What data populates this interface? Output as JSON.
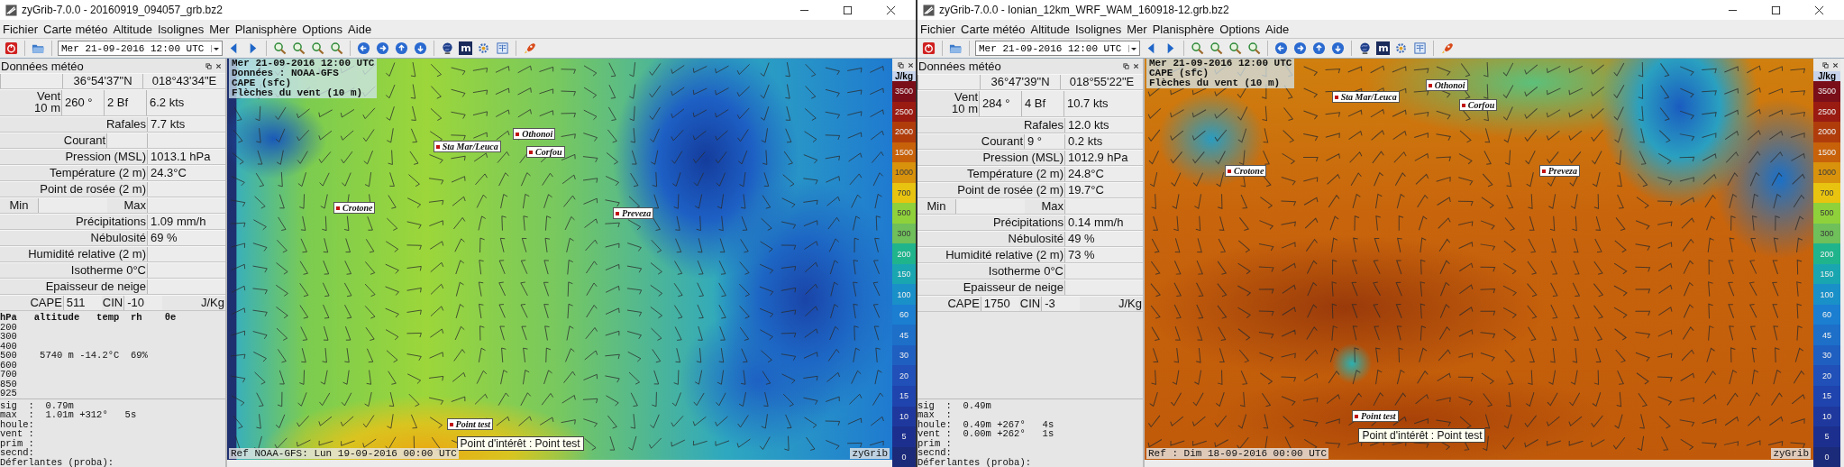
{
  "windows": [
    {
      "title": "zyGrib-7.0.0 - 20160919_094057_grb.bz2",
      "menu": [
        "Fichier",
        "Carte météo",
        "Altitude",
        "Isolignes",
        "Mer",
        "Planisphère",
        "Options",
        "Aide"
      ],
      "toolbar": {
        "date": "Mer 21-09-2016 12:00 UTC",
        "tile": "m"
      },
      "panel": {
        "title": "Données météo",
        "rows": [
          {
            "kind": "coords",
            "value": "36°54'37\"N",
            "value_2": "018°43'34\"E"
          },
          {
            "kind": "wind",
            "label": "Vent",
            "label_2": "10 m",
            "value": "260 °",
            "value_2": "2 Bf",
            "value_3": "6.2  kts"
          },
          {
            "kind": "single",
            "label": "Rafales",
            "value": "7.7  kts"
          },
          {
            "kind": "double",
            "label": "Courant"
          },
          {
            "kind": "single",
            "label": "Pression (MSL)",
            "value": "1013.1 hPa"
          },
          {
            "kind": "single",
            "label": "Température (2 m)",
            "value": "24.3°C"
          },
          {
            "kind": "single",
            "label": "Point de rosée (2 m)"
          },
          {
            "kind": "minmax",
            "label": "Min",
            "label_2": "Max"
          },
          {
            "kind": "single",
            "label": "Précipitations",
            "value": "1.09 mm/h"
          },
          {
            "kind": "single",
            "label": "Nébulosité",
            "value": "69 %"
          },
          {
            "kind": "single",
            "label": "Humidité relative (2 m)"
          },
          {
            "kind": "single",
            "label": "Isotherme 0°C"
          },
          {
            "kind": "single",
            "label": "Epaisseur de neige"
          },
          {
            "kind": "cape",
            "label": "CAPE",
            "value": "511",
            "label_2": "CIN",
            "value_2": "-10",
            "unit": "J/Kg"
          }
        ],
        "sounding": {
          "header": "hPa   altitude   temp  rh    θe",
          "lines": [
            "200",
            "300",
            "400",
            "500    5740 m -14.2°C  69%",
            "600",
            "700",
            "850",
            "925"
          ]
        },
        "waves": [
          "sig  :  0.79m",
          "max  :  1.01m +312°   5s",
          "houle:",
          "vent :",
          "prim :",
          "secnd:",
          "Déferlantes (proba):"
        ]
      },
      "map": {
        "header": [
          "Mer 21-09-2016 12:00 UTC",
          "Données : NOAA-GFS",
          "CAPE (sfc)",
          "Flèches du vent (10 m)"
        ],
        "places": [
          "Sta Mar/Leuca",
          "Othonoi",
          "Corfou",
          "Crotone",
          "Preveza",
          "Point test"
        ],
        "tooltip": "Point d'intérêt : Point test",
        "reference": "Ref NOAA-GFS: Lun 19-09-2016 00:00 UTC",
        "brand": "zyGrib"
      },
      "legend": {
        "unit": "J/kg",
        "items": [
          {
            "label": "3500",
            "color": "#7a0f1a"
          },
          {
            "label": "2500",
            "color": "#9a1b12"
          },
          {
            "label": "2000",
            "color": "#b03c0c"
          },
          {
            "label": "1500",
            "color": "#c8620a"
          },
          {
            "label": "1000",
            "color": "#d9920c"
          },
          {
            "label": "700",
            "color": "#e8c410"
          },
          {
            "label": "500",
            "color": "#8fd13a"
          },
          {
            "label": "300",
            "color": "#6fbf5a"
          },
          {
            "label": "200",
            "color": "#20b48c"
          },
          {
            "label": "150",
            "color": "#1aa6b0"
          },
          {
            "label": "100",
            "color": "#1a90c8"
          },
          {
            "label": "60",
            "color": "#1b7ed0"
          },
          {
            "label": "45",
            "color": "#1d6fc8"
          },
          {
            "label": "30",
            "color": "#1f5fc0"
          },
          {
            "label": "20",
            "color": "#2050b8"
          },
          {
            "label": "15",
            "color": "#1f44ae"
          },
          {
            "label": "10",
            "color": "#1e389e"
          },
          {
            "label": "5",
            "color": "#1d2f8e"
          },
          {
            "label": "0",
            "color": "#1c2a7a"
          }
        ]
      }
    },
    {
      "title": "zyGrib-7.0.0 - Ionian_12km_WRF_WAM_160918-12.grb.bz2",
      "menu": [
        "Fichier",
        "Carte météo",
        "Altitude",
        "Isolignes",
        "Mer",
        "Planisphère",
        "Options",
        "Aide"
      ],
      "toolbar": {
        "date": "Mer 21-09-2016 12:00 UTC",
        "tile": "m"
      },
      "panel": {
        "title": "Données météo",
        "rows": [
          {
            "kind": "coords",
            "value": "36°47'39\"N",
            "value_2": "018°55'22\"E"
          },
          {
            "kind": "wind",
            "label": "Vent",
            "label_2": "10 m",
            "value": "284 °",
            "value_2": "4 Bf",
            "value_3": "10.7  kts"
          },
          {
            "kind": "single",
            "label": "Rafales",
            "value": "12.0  kts"
          },
          {
            "kind": "double",
            "label": "Courant",
            "value": "9 °",
            "value_2": "0.2  kts"
          },
          {
            "kind": "single",
            "label": "Pression (MSL)",
            "value": "1012.9 hPa"
          },
          {
            "kind": "single",
            "label": "Température (2 m)",
            "value": "24.8°C"
          },
          {
            "kind": "single",
            "label": "Point de rosée (2 m)",
            "value": "19.7°C"
          },
          {
            "kind": "minmax",
            "label": "Min",
            "label_2": "Max"
          },
          {
            "kind": "single",
            "label": "Précipitations",
            "value": "0.14 mm/h"
          },
          {
            "kind": "single",
            "label": "Nébulosité",
            "value": "49 %"
          },
          {
            "kind": "single",
            "label": "Humidité relative (2 m)",
            "value": "73 %"
          },
          {
            "kind": "single",
            "label": "Isotherme 0°C"
          },
          {
            "kind": "single",
            "label": "Epaisseur de neige"
          },
          {
            "kind": "cape",
            "label": "CAPE",
            "value": "1750",
            "label_2": "CIN",
            "value_2": "-3",
            "unit": "J/Kg"
          }
        ],
        "waves": [
          "sig  :  0.49m",
          "max  :",
          "houle:  0.49m +267°   4s",
          "vent :  0.00m +262°   1s",
          "prim :",
          "secnd:",
          "Déferlantes (proba):"
        ]
      },
      "map": {
        "header": [
          "Mer 21-09-2016 12:00 UTC",
          "CAPE (sfc)",
          "Flèches du vent (10 m)"
        ],
        "places": [
          "Sta Mar/Leuca",
          "Othonoi",
          "Corfou",
          "Crotone",
          "Preveza",
          "Point test"
        ],
        "tooltip": "Point d'intérêt : Point test",
        "reference": "Ref : Dim 18-09-2016 00:00 UTC",
        "brand": "zyGrib"
      },
      "legend": {
        "unit": "J/kg",
        "items": [
          {
            "label": "3500",
            "color": "#7a0f1a"
          },
          {
            "label": "2500",
            "color": "#9a1b12"
          },
          {
            "label": "2000",
            "color": "#b03c0c"
          },
          {
            "label": "1500",
            "color": "#c8620a"
          },
          {
            "label": "1000",
            "color": "#d9920c"
          },
          {
            "label": "700",
            "color": "#e8c410"
          },
          {
            "label": "500",
            "color": "#8fd13a"
          },
          {
            "label": "300",
            "color": "#6fbf5a"
          },
          {
            "label": "200",
            "color": "#20b48c"
          },
          {
            "label": "150",
            "color": "#1aa6b0"
          },
          {
            "label": "100",
            "color": "#1a90c8"
          },
          {
            "label": "60",
            "color": "#1b7ed0"
          },
          {
            "label": "45",
            "color": "#1d6fc8"
          },
          {
            "label": "30",
            "color": "#1f5fc0"
          },
          {
            "label": "20",
            "color": "#2050b8"
          },
          {
            "label": "15",
            "color": "#1f44ae"
          },
          {
            "label": "10",
            "color": "#1e389e"
          },
          {
            "label": "5",
            "color": "#1d2f8e"
          },
          {
            "label": "0",
            "color": "#1c2a7a"
          }
        ]
      }
    }
  ]
}
